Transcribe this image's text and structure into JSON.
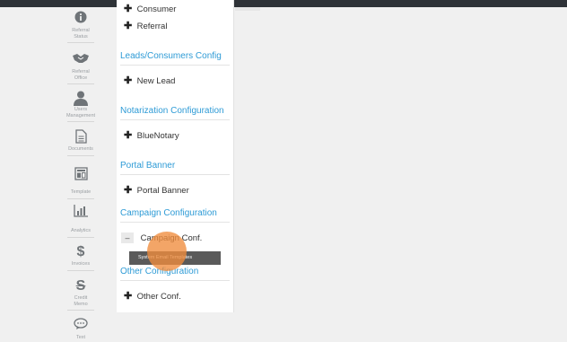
{
  "rail": [
    {
      "key": "referral_status",
      "label": "Referral Status",
      "icon": "info-icon"
    },
    {
      "key": "referral_office",
      "label": "Referral Office",
      "icon": "handshake-icon"
    },
    {
      "key": "users_management",
      "label": "Users Management",
      "icon": "user-icon"
    },
    {
      "key": "documents",
      "label": "Documents",
      "icon": "document-icon"
    },
    {
      "key": "template",
      "label": "Template",
      "icon": "template-icon"
    },
    {
      "key": "analytics",
      "label": "Analytics",
      "icon": "bar-chart-icon"
    },
    {
      "key": "invoices",
      "label": "Invoices",
      "icon": "dollar-icon"
    },
    {
      "key": "credit_memo",
      "label": "Credit Memo",
      "icon": "strikethrough-s-icon"
    },
    {
      "key": "text",
      "label": "Text",
      "icon": "chat-bubble-icon"
    }
  ],
  "panel": {
    "top_items": [
      "Consumer",
      "Referral"
    ],
    "sections": [
      {
        "title": "Leads/Consumers Config",
        "items": [
          "New Lead"
        ]
      },
      {
        "title": "Notarization Configuration",
        "items": [
          "BlueNotary"
        ]
      },
      {
        "title": "Portal Banner",
        "items": [
          "Portal Banner"
        ]
      },
      {
        "title": "Campaign Configuration",
        "items": [
          "Campaign Conf."
        ]
      },
      {
        "title": "Other Configuration",
        "items": [
          "Other Conf."
        ]
      }
    ]
  },
  "tooltip": "System Email Templates",
  "symbols": {
    "plus": "✚",
    "minus": "–"
  },
  "colors": {
    "section_title": "#2e9bd6",
    "topbar": "#2e3237",
    "cursor": "#f08c3c"
  }
}
